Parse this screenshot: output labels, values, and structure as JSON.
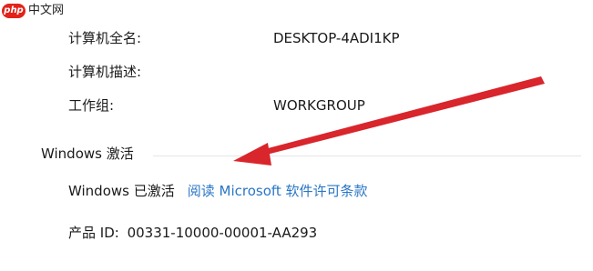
{
  "watermark": {
    "badge": "php",
    "text": "中文网"
  },
  "computer_info": {
    "full_name_label": "计算机全名:",
    "full_name_value": "DESKTOP-4ADI1KP",
    "description_label": "计算机描述:",
    "description_value": "",
    "workgroup_label": "工作组:",
    "workgroup_value": "WORKGROUP"
  },
  "activation": {
    "section_title": "Windows 激活",
    "status_text": "Windows 已激活",
    "license_link": "阅读 Microsoft 软件许可条款",
    "product_id_label": "产品 ID:",
    "product_id_value": "00331-10000-00001-AA293"
  },
  "colors": {
    "link": "#2a76c6",
    "annotation_arrow": "#d9252c",
    "watermark_badge": "#e2231a"
  },
  "icons": {
    "annotation": "red-arrow-icon"
  }
}
